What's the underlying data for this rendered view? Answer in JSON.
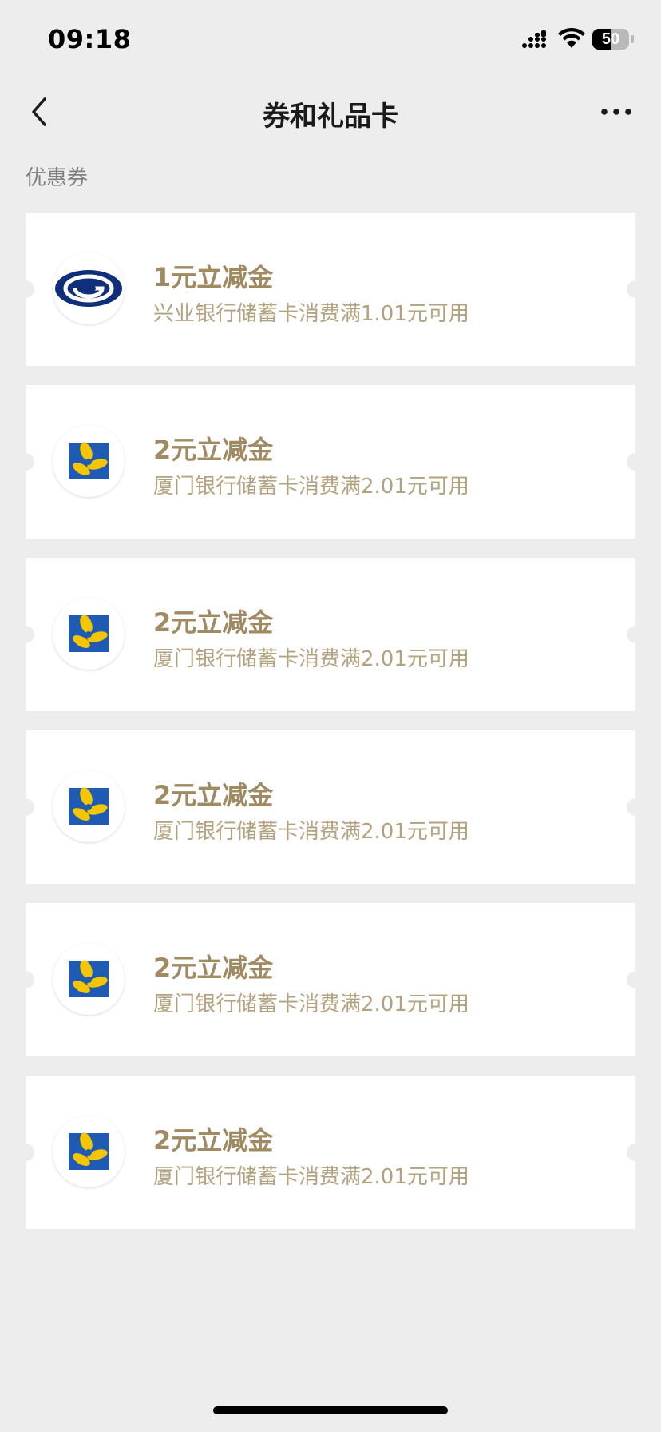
{
  "status_bar": {
    "time": "09:18",
    "battery_level": "50",
    "battery_fraction": 0.5
  },
  "nav": {
    "title": "券和礼品卡",
    "back_icon": "chevron-left-icon",
    "more_icon": "more-dots-icon"
  },
  "section": {
    "title": "优惠券"
  },
  "colors": {
    "background": "#ededed",
    "card": "#ffffff",
    "coupon_title": "#a08a62",
    "coupon_desc": "#b4a27f",
    "cib_blue": "#0f2f7a",
    "xmbank_blue": "#1f5bb5",
    "xmbank_yellow": "#f5c500"
  },
  "coupons": [
    {
      "title": "1元立减金",
      "desc": "兴业银行储蓄卡消费满1.01元可用",
      "logo": "cib-bank-logo-icon"
    },
    {
      "title": "2元立减金",
      "desc": "厦门银行储蓄卡消费满2.01元可用",
      "logo": "xiamen-bank-logo-icon"
    },
    {
      "title": "2元立减金",
      "desc": "厦门银行储蓄卡消费满2.01元可用",
      "logo": "xiamen-bank-logo-icon"
    },
    {
      "title": "2元立减金",
      "desc": "厦门银行储蓄卡消费满2.01元可用",
      "logo": "xiamen-bank-logo-icon"
    },
    {
      "title": "2元立减金",
      "desc": "厦门银行储蓄卡消费满2.01元可用",
      "logo": "xiamen-bank-logo-icon"
    },
    {
      "title": "2元立减金",
      "desc": "厦门银行储蓄卡消费满2.01元可用",
      "logo": "xiamen-bank-logo-icon"
    }
  ]
}
